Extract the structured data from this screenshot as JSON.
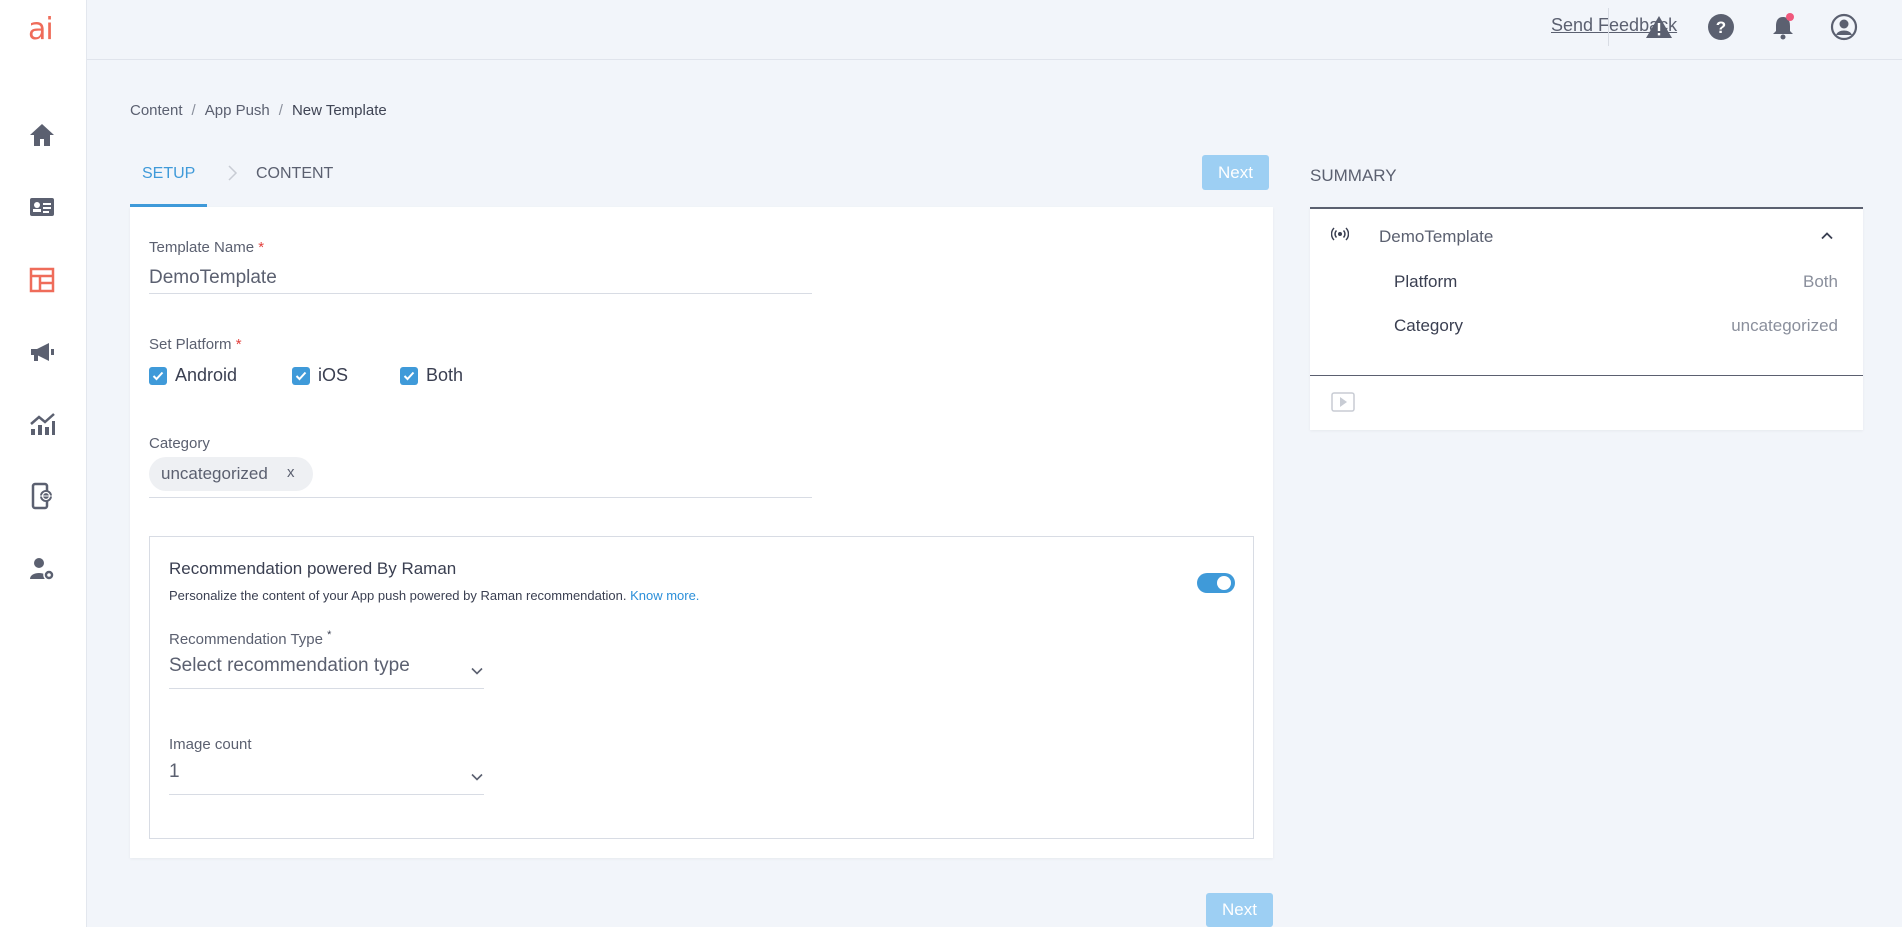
{
  "app": {
    "logo_text": "ai"
  },
  "sidebar": {
    "items": [
      {
        "icon": "home-icon"
      },
      {
        "icon": "contact-card-icon"
      },
      {
        "icon": "template-icon",
        "active": true
      },
      {
        "icon": "megaphone-icon"
      },
      {
        "icon": "analytics-icon"
      },
      {
        "icon": "mobile-web-icon"
      },
      {
        "icon": "user-settings-icon"
      }
    ]
  },
  "topbar": {
    "feedback_label": "Send Feedback",
    "icons": [
      "warning-icon",
      "help-icon",
      "bell-icon",
      "user-icon"
    ]
  },
  "breadcrumb": {
    "items": [
      "Content",
      "App Push",
      "New Template"
    ],
    "separator": "/"
  },
  "steps": {
    "setup_label": "SETUP",
    "content_label": "CONTENT",
    "next_label": "Next"
  },
  "form": {
    "template_name_label": "Template Name",
    "template_name_value": "DemoTemplate",
    "required_mark": "*",
    "platform_label": "Set Platform",
    "platforms": [
      "Android",
      "iOS",
      "Both"
    ],
    "category_label": "Category",
    "category_chip": "uncategorized",
    "chip_remove": "x",
    "recommendation": {
      "title": "Recommendation powered By Raman",
      "description": "Personalize the content of your App push powered by Raman recommendation.",
      "link_text": "Know more.",
      "type_label": "Recommendation Type",
      "type_placeholder": "Select recommendation type",
      "image_count_label": "Image count",
      "image_count_value": "1",
      "enabled": true
    },
    "next_label": "Next"
  },
  "summary": {
    "title": "SUMMARY",
    "name": "DemoTemplate",
    "rows": [
      {
        "label": "Platform",
        "value": "Both"
      },
      {
        "label": "Category",
        "value": "uncategorized"
      }
    ]
  },
  "colors": {
    "accent": "#3f9ad9",
    "brand": "#ef6c5a",
    "button_disabled": "#9dcff3",
    "background": "#f2f5fa"
  }
}
